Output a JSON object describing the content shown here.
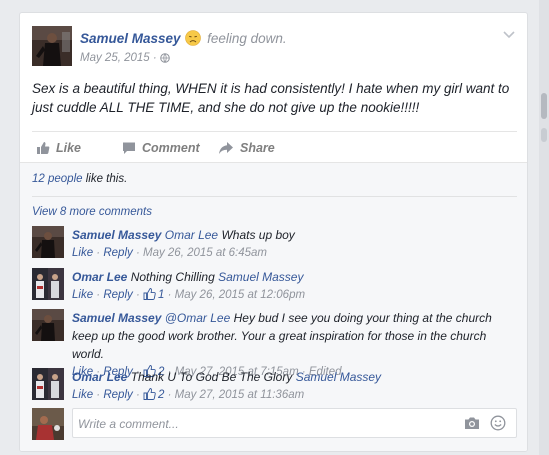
{
  "post": {
    "author": "Samuel Massey",
    "feeling": "feeling down.",
    "date": "May 25, 2015 ·",
    "text": "Sex is a beautiful thing, WHEN it is had consistently! I hate when my girl want to just cuddle ALL THE TIME, and she do not give up the nookie!!!!!"
  },
  "actions": {
    "like": "Like",
    "comment": "Comment",
    "share": "Share"
  },
  "likes": {
    "people": "12 people",
    "suffix": "like this."
  },
  "view_more": "View 8 more comments",
  "comments": [
    {
      "author": "Samuel Massey",
      "tag": "Omar Lee",
      "text": "Whats up boy",
      "tag_after": "",
      "like": "Like",
      "reply": "Reply",
      "likes_count": "",
      "time": "May 26, 2015 at 6:45am",
      "edited": ""
    },
    {
      "author": "Omar Lee",
      "tag": "",
      "text": "Nothing Chilling",
      "tag_after": "Samuel Massey",
      "like": "Like",
      "reply": "Reply",
      "likes_count": "1",
      "time": "May 26, 2015 at 12:06pm",
      "edited": ""
    },
    {
      "author": "Samuel Massey",
      "tag": "@Omar Lee",
      "text": "Hey bud I see you doing your thing at the church keep up the good work brother. Your a great inspiration for those in the church world.",
      "tag_after": "",
      "like": "Like",
      "reply": "Reply",
      "likes_count": "2",
      "time": "May 27, 2015 at 7:15am",
      "edited": "Edited"
    },
    {
      "author": "Omar Lee",
      "tag": "",
      "text": "Thank U To God Be The Glory",
      "tag_after": "Samuel Massey",
      "like": "Like",
      "reply": "Reply",
      "likes_count": "2",
      "time": "May 27, 2015 at 11:36am",
      "edited": ""
    }
  ],
  "composer": {
    "placeholder": "Write a comment..."
  },
  "colors": {
    "link": "#365899",
    "meta": "#90949c",
    "background": "#e9ebee"
  },
  "icons": [
    "chevron-down-icon",
    "sad-emoji-icon",
    "globe-icon",
    "like-icon",
    "comment-icon",
    "share-icon",
    "thumbs-up-icon",
    "camera-icon",
    "smiley-icon"
  ]
}
